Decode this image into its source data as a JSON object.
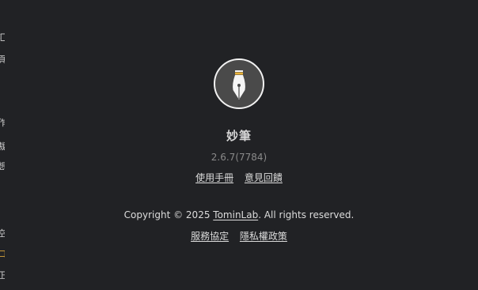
{
  "app": {
    "name": "妙筆",
    "version": "2.6.7(7784)"
  },
  "links": {
    "manual": "使用手冊",
    "feedback": "意見回饋",
    "terms": "服務協定",
    "privacy": "隱私權政策"
  },
  "copyright": {
    "prefix": "Copyright © 2025 ",
    "company": "TominLab",
    "suffix": ". All rights reserved."
  },
  "colors": {
    "background": "#212225",
    "logo_circle": "#4a4a4a",
    "logo_accent": "#e8b23a"
  },
  "logo_icon": "fountain-pen-nib-icon"
}
